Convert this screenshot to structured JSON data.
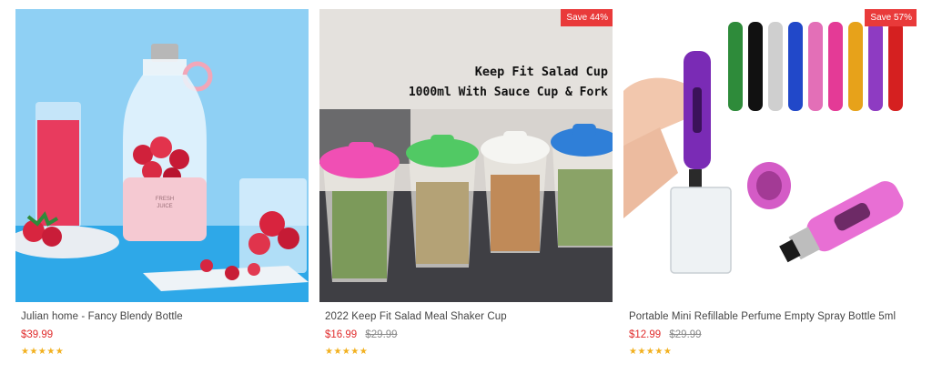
{
  "colors": {
    "sale_badge": "#e93a3a",
    "price": "#e02b2b",
    "old_price": "#8a8a8a",
    "star": "#f2b01e"
  },
  "products": [
    {
      "name": "Julian home - Fancy Blendy Bottle",
      "price": "$39.99",
      "old_price": "",
      "badge": "",
      "rating": 5,
      "stars": "★★★★★"
    },
    {
      "name": "2022 Keep Fit Salad Meal Shaker Cup",
      "price": "$16.99",
      "old_price": "$29.99",
      "badge": "Save 44%",
      "rating": 5,
      "stars": "★★★★★",
      "image_text": {
        "line1": "Keep Fit Salad Cup",
        "line2": "1000ml With Sauce Cup & Fork"
      }
    },
    {
      "name": "Portable Mini Refillable Perfume Empty Spray Bottle 5ml",
      "price": "$12.99",
      "old_price": "$29.99",
      "badge": "Save 57%",
      "rating": 5,
      "stars": "★★★★★"
    }
  ]
}
